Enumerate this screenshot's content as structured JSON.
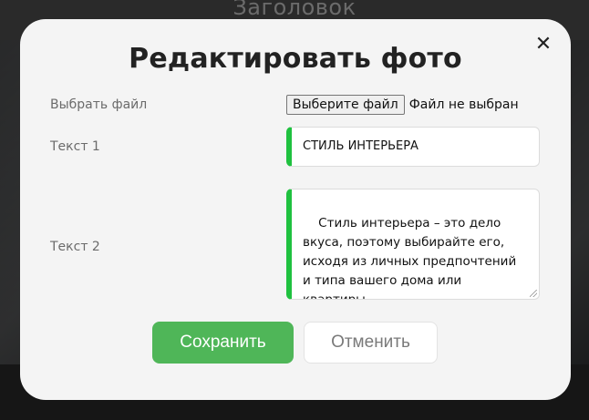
{
  "background": {
    "header_title": "Заголовок"
  },
  "modal": {
    "title": "Редактировать фото",
    "close_symbol": "✕",
    "fields": {
      "file_label": "Выбрать файл",
      "file_button": "Выберите файл",
      "file_status": "Файл не выбран",
      "text1_label": "Текст 1",
      "text1_value": "СТИЛЬ ИНТЕРЬЕРА",
      "text2_label": "Текст 2",
      "text2_value": "Стиль интерьера – это дело вкуса, поэтому выбирайте его, исходя из личных предпочтений и типа вашего дома или квартиры."
    },
    "buttons": {
      "save": "Сохранить",
      "cancel": "Отменить"
    }
  },
  "colors": {
    "accent_green": "#1fc13f",
    "save_button": "#4fb658",
    "modal_bg": "#f4f4f4"
  },
  "icons": {
    "close": "close-icon"
  }
}
